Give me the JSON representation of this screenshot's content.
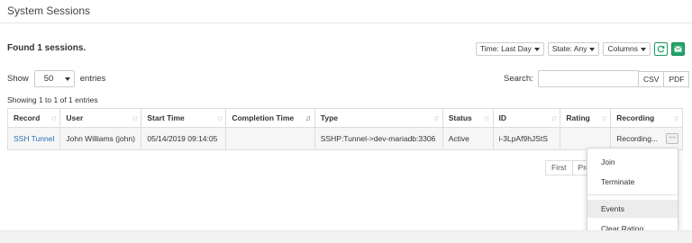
{
  "panel": {
    "title": "System Sessions"
  },
  "summary": {
    "found": "Found 1 sessions."
  },
  "toolbar": {
    "time_filter": "Time: Last Day",
    "state_filter": "State: Any",
    "columns": "Columns",
    "refresh_icon": "refresh-icon",
    "email_icon": "envelope-icon",
    "accent": "#23a56b"
  },
  "length": {
    "show": "Show",
    "value": "50",
    "entries": "entries"
  },
  "search": {
    "label": "Search:",
    "value": ""
  },
  "export": {
    "csv": "CSV",
    "pdf": "PDF"
  },
  "info": "Showing 1 to 1 of 1 entries",
  "table": {
    "columns": [
      "Record",
      "User",
      "Start Time",
      "Completion Time",
      "Type",
      "Status",
      "ID",
      "Rating",
      "Recording"
    ],
    "sorted_column": "Completion Time",
    "rows": [
      {
        "record": "SSH Tunnel",
        "user": "John Williams (john)",
        "start_time": "05/14/2019 09:14:05",
        "completion_time": "",
        "type": "SSHP:Tunnel->dev-mariadb:3306",
        "status": "Active",
        "id": "i-3LpAf9hJStS",
        "rating": "",
        "recording": "Recording..."
      }
    ],
    "row_action_label": "···"
  },
  "pagination": {
    "first": "First",
    "previous_partial": "Pre"
  },
  "row_menu": {
    "items": [
      "Join",
      "Terminate",
      "Events",
      "Clear Rating"
    ],
    "highlighted": "Events"
  }
}
